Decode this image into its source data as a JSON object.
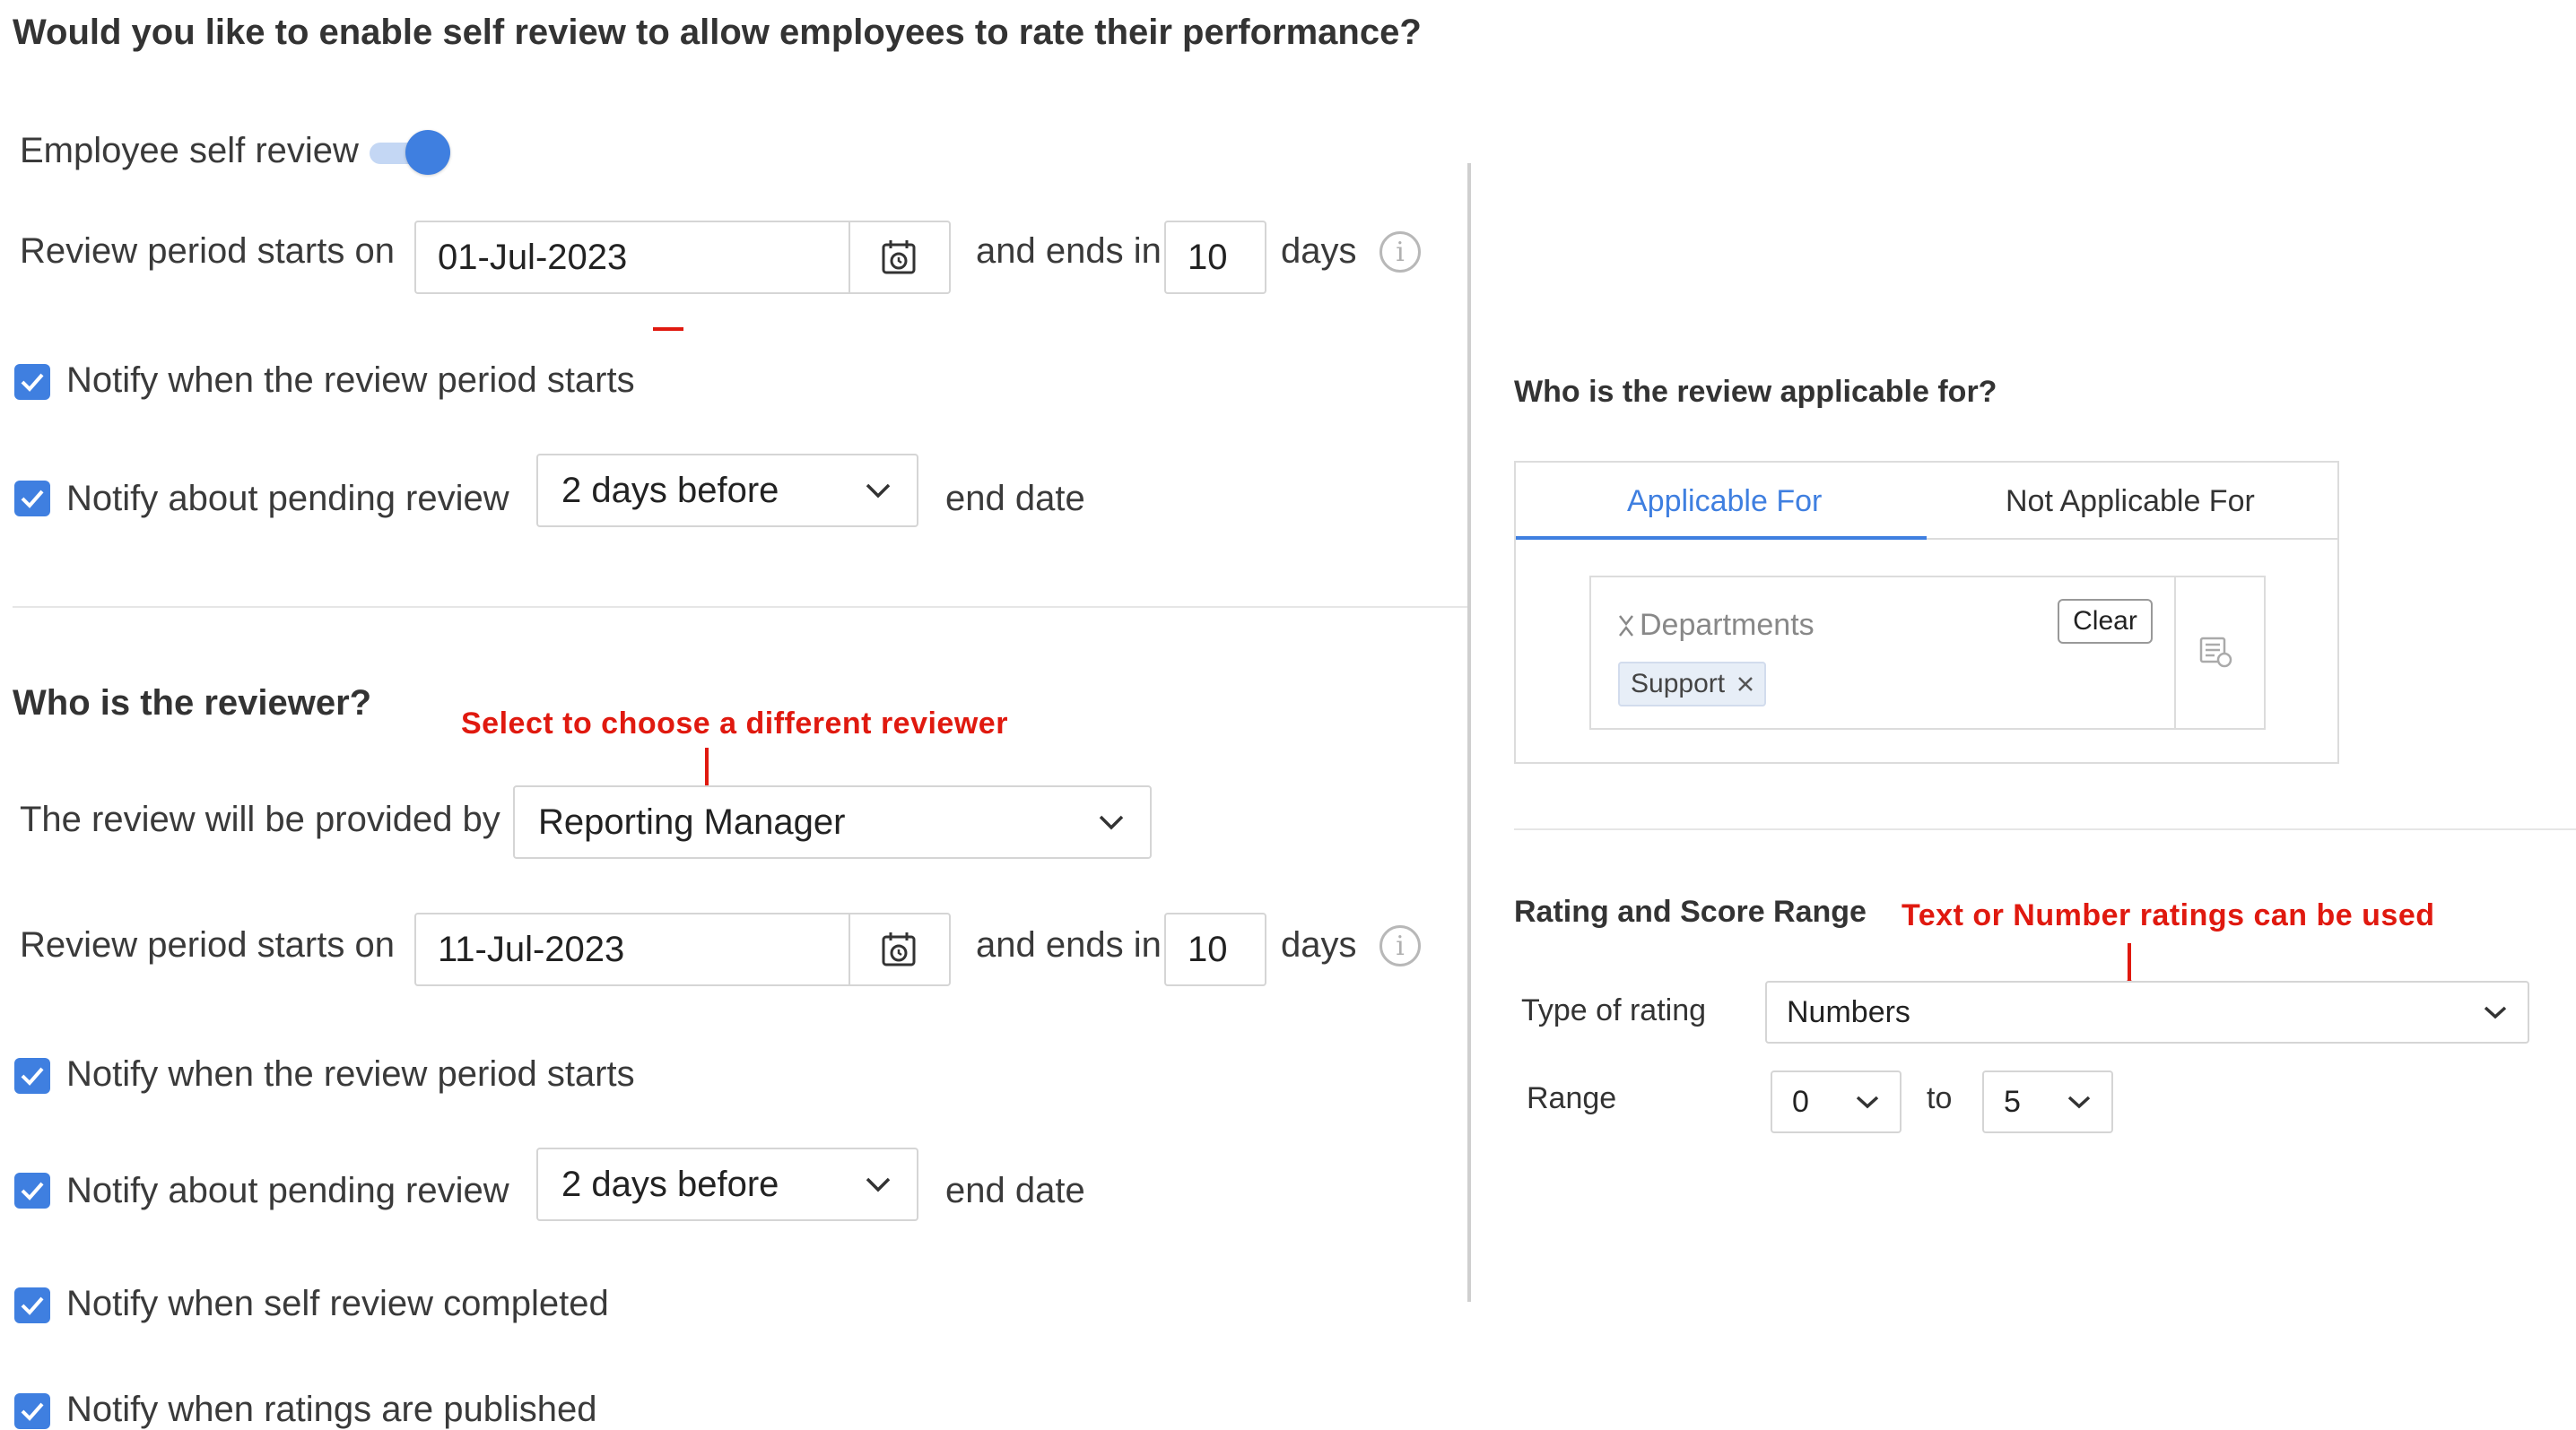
{
  "question": "Would you like to enable self review to allow employees to rate their performance?",
  "self_review": {
    "toggle_label": "Employee self review",
    "toggle_on": true,
    "period_label": "Review period starts on",
    "start_date": "01-Jul-2023",
    "ends_in_label": "and ends in",
    "ends_in_value": "10",
    "days_label": "days",
    "notify_start_label": "Notify when the review period starts",
    "notify_start_checked": true,
    "notify_pending_label": "Notify about pending review",
    "notify_pending_checked": true,
    "pending_option": "2 days before",
    "end_date_label": "end date"
  },
  "reviewer": {
    "title": "Who is the reviewer?",
    "annotation": "Select to choose a different reviewer",
    "provided_by_label": "The review will be provided by",
    "provided_by_value": "Reporting Manager",
    "period_label": "Review period starts on",
    "start_date": "11-Jul-2023",
    "ends_in_label": "and ends in",
    "ends_in_value": "10",
    "days_label": "days",
    "notify_start_label": "Notify when the review period starts",
    "notify_pending_label": "Notify about pending review",
    "pending_option": "2 days before",
    "end_date_label": "end date",
    "notify_self_completed_label": "Notify when self review completed",
    "notify_published_label": "Notify when ratings are published"
  },
  "applicable": {
    "title": "Who is the review applicable for?",
    "tabs": [
      "Applicable For",
      "Not Applicable For"
    ],
    "active_tab": "Applicable For",
    "filter_type": "Departments",
    "clear_label": "Clear",
    "chips": [
      "Support"
    ]
  },
  "rating": {
    "title": "Rating and Score Range",
    "annotation": "Text or Number ratings can be used",
    "type_label": "Type of rating",
    "type_value": "Numbers",
    "range_label": "Range",
    "range_from": "0",
    "range_to_label": "to",
    "range_to": "5"
  },
  "colors": {
    "accent": "#3f7fe0",
    "annotation": "#e0190f"
  }
}
